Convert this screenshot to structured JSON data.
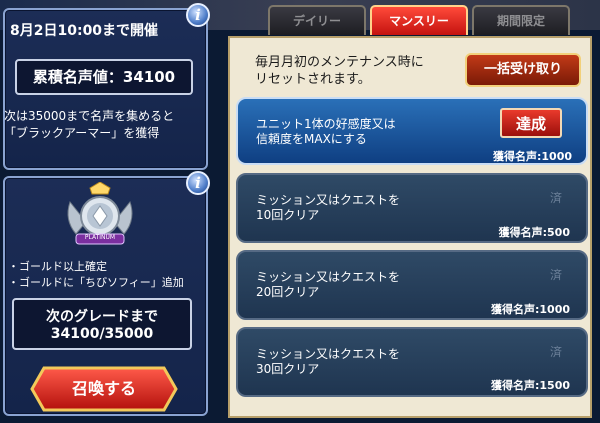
{
  "event": {
    "period": "8月2日10:00まで開催",
    "total_fame": "累積名声値：34100",
    "next_reward_line1": "次は35000まで名声を集めると",
    "next_reward_line2": "「ブラックアーマー」を獲得"
  },
  "grade": {
    "badge_label": "PLATINUM",
    "bullet1": "・ゴールド以上確定",
    "bullet2": "・ゴールドに「ちびソフィー」追加",
    "next_title": "次のグレードまで",
    "next_value": "34100/35000",
    "summon_label": "召喚する"
  },
  "tabs": [
    {
      "label": "デイリー",
      "active": false
    },
    {
      "label": "マンスリー",
      "active": true
    },
    {
      "label": "期間限定",
      "active": false
    }
  ],
  "notice": {
    "line1": "毎月月初のメンテナンス時に",
    "line2": "リセットされます。",
    "bulk_claim_label": "一括受け取り"
  },
  "missions": [
    {
      "line1": "ユニット1体の好感度又は",
      "line2": "信頼度をMAXにする",
      "reward": "獲得名声:1000",
      "status": "達成"
    },
    {
      "line1": "ミッション又はクエストを",
      "line2": "10回クリア",
      "reward": "獲得名声:500",
      "status": "済"
    },
    {
      "line1": "ミッション又はクエストを",
      "line2": "20回クリア",
      "reward": "獲得名声:1000",
      "status": "済"
    },
    {
      "line1": "ミッション又はクエストを",
      "line2": "30回クリア",
      "reward": "獲得名声:1500",
      "status": "済"
    }
  ],
  "colors": {
    "accent_red": "#d9211c",
    "panel_blue": "#1c2d56",
    "gold": "#c89a3c"
  }
}
